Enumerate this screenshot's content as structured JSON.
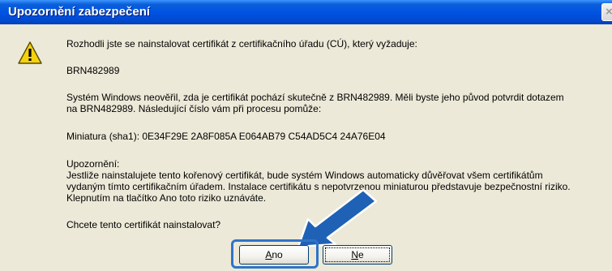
{
  "window": {
    "title": "Upozornění zabezpečení",
    "close_label": "×"
  },
  "message": {
    "intro": "Rozhodli jste se nainstalovat certifikát z certifikačního úřadu (CÚ), který vyžaduje:",
    "issuer": "BRN482989",
    "verify_line1": "Systém Windows neověřil, zda je certifikát pochází skutečně z BRN482989. Měli byste jeho původ potvrdit dotazem",
    "verify_line2": "na BRN482989. Následující číslo vám při procesu pomůže:",
    "thumbprint": "Miniatura (sha1): 0E34F29E 2A8F085A E064AB79 C54AD5C4 24A76E04",
    "warning_heading": "Upozornění:",
    "warning_line1": "Jestliže nainstalujete tento kořenový certifikát, bude systém Windows automaticky důvěřovat všem certifikátům",
    "warning_line2": "vydaným tímto certifikačním úřadem. Instalace certifikátu s nepotvrzenou miniaturou představuje bezpečnostní riziko.",
    "warning_line3": "Klepnutím na tlačítko Ano toto riziko uznáváte.",
    "question": "Chcete tento certifikát nainstalovat?"
  },
  "buttons": {
    "yes_accel": "A",
    "yes_rest": "no",
    "no_accel": "N",
    "no_rest": "e"
  },
  "icons": {
    "warning": "warning-triangle-icon",
    "arrow": "blue-arrow-icon"
  },
  "colors": {
    "titlebar": "#0054e3",
    "dialog_bg": "#ece9d8",
    "highlight": "#2f74c9"
  }
}
